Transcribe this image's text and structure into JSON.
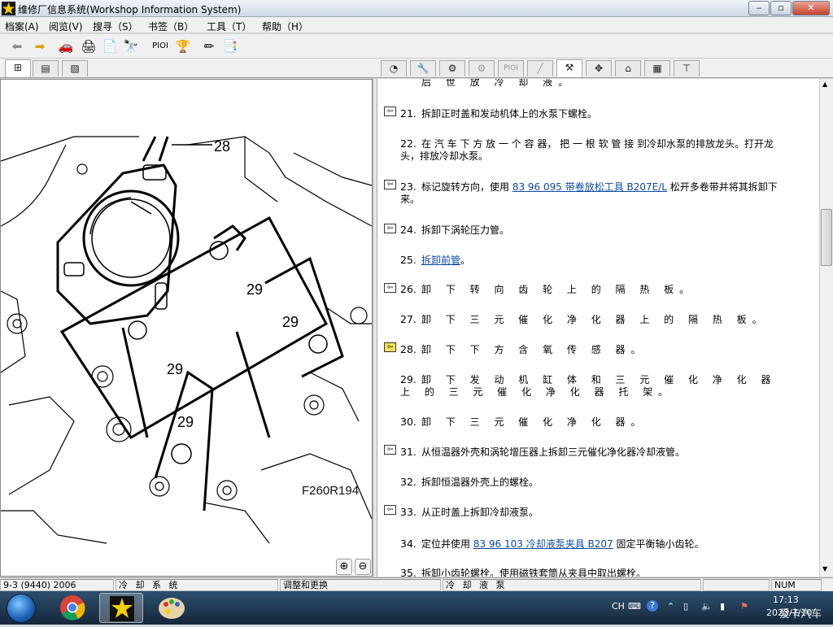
{
  "window": {
    "title": "维修厂信息系统(Workshop Information System)",
    "min": "‒",
    "max": "▫",
    "close": "✕"
  },
  "menu": [
    "档案(A)",
    "阅览(V)",
    "搜寻（S）",
    "书签（B）",
    "工具（T）",
    "帮助（H）"
  ],
  "toolbar": {
    "pio_label": "PIOI"
  },
  "right_tabs": {
    "pio_label": "PIOI"
  },
  "figure": {
    "id": "F260R194",
    "callouts": [
      "28",
      "29",
      "29",
      "29",
      "29"
    ]
  },
  "steps": [
    {
      "num": "",
      "text": "后 世 放 冷 却 液。"
    },
    {
      "num": "21.",
      "text": "拆卸正时盖和发动机体上的水泵下螺栓。"
    },
    {
      "num": "22.",
      "text": "在 汽 车 下 方 放 一 个 容 器， 把 一 根 软 管 接 到冷却水泵的排放龙头。打开龙头，排放冷却水泵。"
    },
    {
      "num": "23.",
      "pre": "标记旋转方向，使用 ",
      "link": "83 96 095 带卷放松工具 B207E/L",
      "post": " 松开多卷带并将其拆卸下来。"
    },
    {
      "num": "24.",
      "text": "拆卸下涡轮压力管。"
    },
    {
      "num": "25.",
      "link": "拆卸前管",
      "post": "。"
    },
    {
      "num": "26.",
      "text": "卸 下 转 向 齿 轮 上 的 隔 热 板。"
    },
    {
      "num": "27.",
      "text": "卸 下 三 元 催 化 净 化 器 上 的 隔 热 板。"
    },
    {
      "num": "28.",
      "text": "卸 下 下 方 含 氧 传 感 器。"
    },
    {
      "num": "29.",
      "text": "卸 下 发 动 机 缸 体 和 三 元 催 化 净 化 器 上 的 三 元 催 化 净 化 器 托 架。"
    },
    {
      "num": "30.",
      "text": "卸 下 三 元 催 化 净 化 器。"
    },
    {
      "num": "31.",
      "text": "从恒温器外壳和涡轮增压器上拆卸三元催化净化器冷却液管。"
    },
    {
      "num": "32.",
      "text": "拆卸恒温器外壳上的螺栓。"
    },
    {
      "num": "33.",
      "text": "从正时盖上拆卸冷却液泵。"
    },
    {
      "num": "34.",
      "pre": "定位并使用 ",
      "link": "83 96 103 冷却液泵夹具 B207",
      "post": " 固定平衡轴小齿轮。"
    },
    {
      "num": "35.",
      "text": "拆卸小齿轮螺栓。使用磁铁套筒从夹具中取出螺栓。"
    }
  ],
  "status": [
    "9-3 (9440) 2006",
    "冷 却 系 统",
    "调整和更换",
    "冷 却 液 泵",
    "",
    "",
    "NUM"
  ],
  "taskbar": {
    "lang": "CH",
    "time": "17:13",
    "date": "2023/7/10",
    "watermark": "爱卡汽车"
  }
}
